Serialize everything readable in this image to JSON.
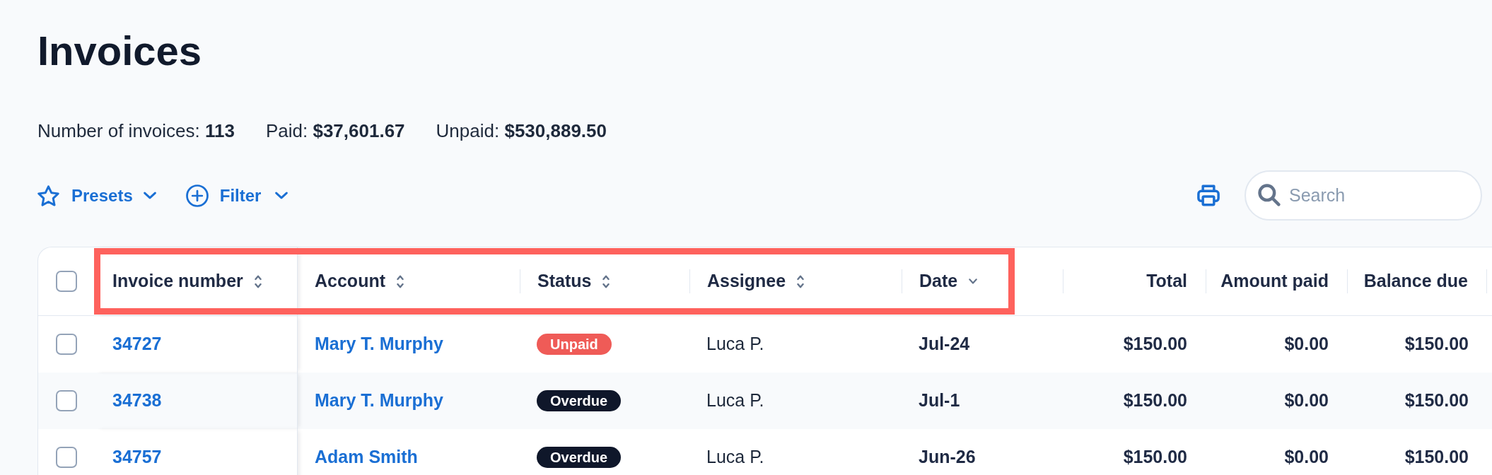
{
  "page": {
    "title": "Invoices"
  },
  "stats": [
    "Number of invoices: **113**",
    "Paid: **$37,601.67**",
    "Unpaid: **$530,889.50**"
  ],
  "toolbar": {
    "presets": {
      "label": "Presets"
    },
    "filter": {
      "label": "Filter"
    },
    "search": {
      "placeholder": "Search"
    }
  },
  "table": {
    "select_all": {
      "checked": false
    },
    "header_highlighted": true,
    "columns": [
      {
        "label": "Invoice number",
        "kind": "sortable"
      },
      {
        "label": "Account",
        "kind": "sortable"
      },
      {
        "label": "Status",
        "kind": "sortable"
      },
      {
        "label": "Assignee",
        "kind": "sortable"
      },
      {
        "label": "Date",
        "kind": "sorted"
      },
      {
        "label": "Total",
        "kind": "amount"
      },
      {
        "label": "Amount paid",
        "kind": "amount"
      },
      {
        "label": "Balance due",
        "kind": "amount"
      }
    ],
    "rows": [
      {
        "checked": false,
        "invoice_number": "34727",
        "account": "Mary T. Murphy",
        "status": {
          "label": "Unpaid",
          "kind": "unpaid"
        },
        "assignee": "Luca P.",
        "date": "Jul-24",
        "total": "$150.00",
        "amount_paid": "$0.00",
        "balance_due": "$150.00"
      },
      {
        "checked": false,
        "invoice_number": "34738",
        "account": "Mary T. Murphy",
        "status": {
          "label": "Overdue",
          "kind": "overdue"
        },
        "assignee": "Luca P.",
        "date": "Jul-1",
        "total": "$150.00",
        "amount_paid": "$0.00",
        "balance_due": "$150.00"
      },
      {
        "checked": false,
        "invoice_number": "34757",
        "account": "Adam Smith",
        "status": {
          "label": "Overdue",
          "kind": "overdue"
        },
        "assignee": "Luca P.",
        "date": "Jun-26",
        "total": "$150.00",
        "amount_paid": "$0.00",
        "balance_due": "$150.00"
      }
    ]
  }
}
